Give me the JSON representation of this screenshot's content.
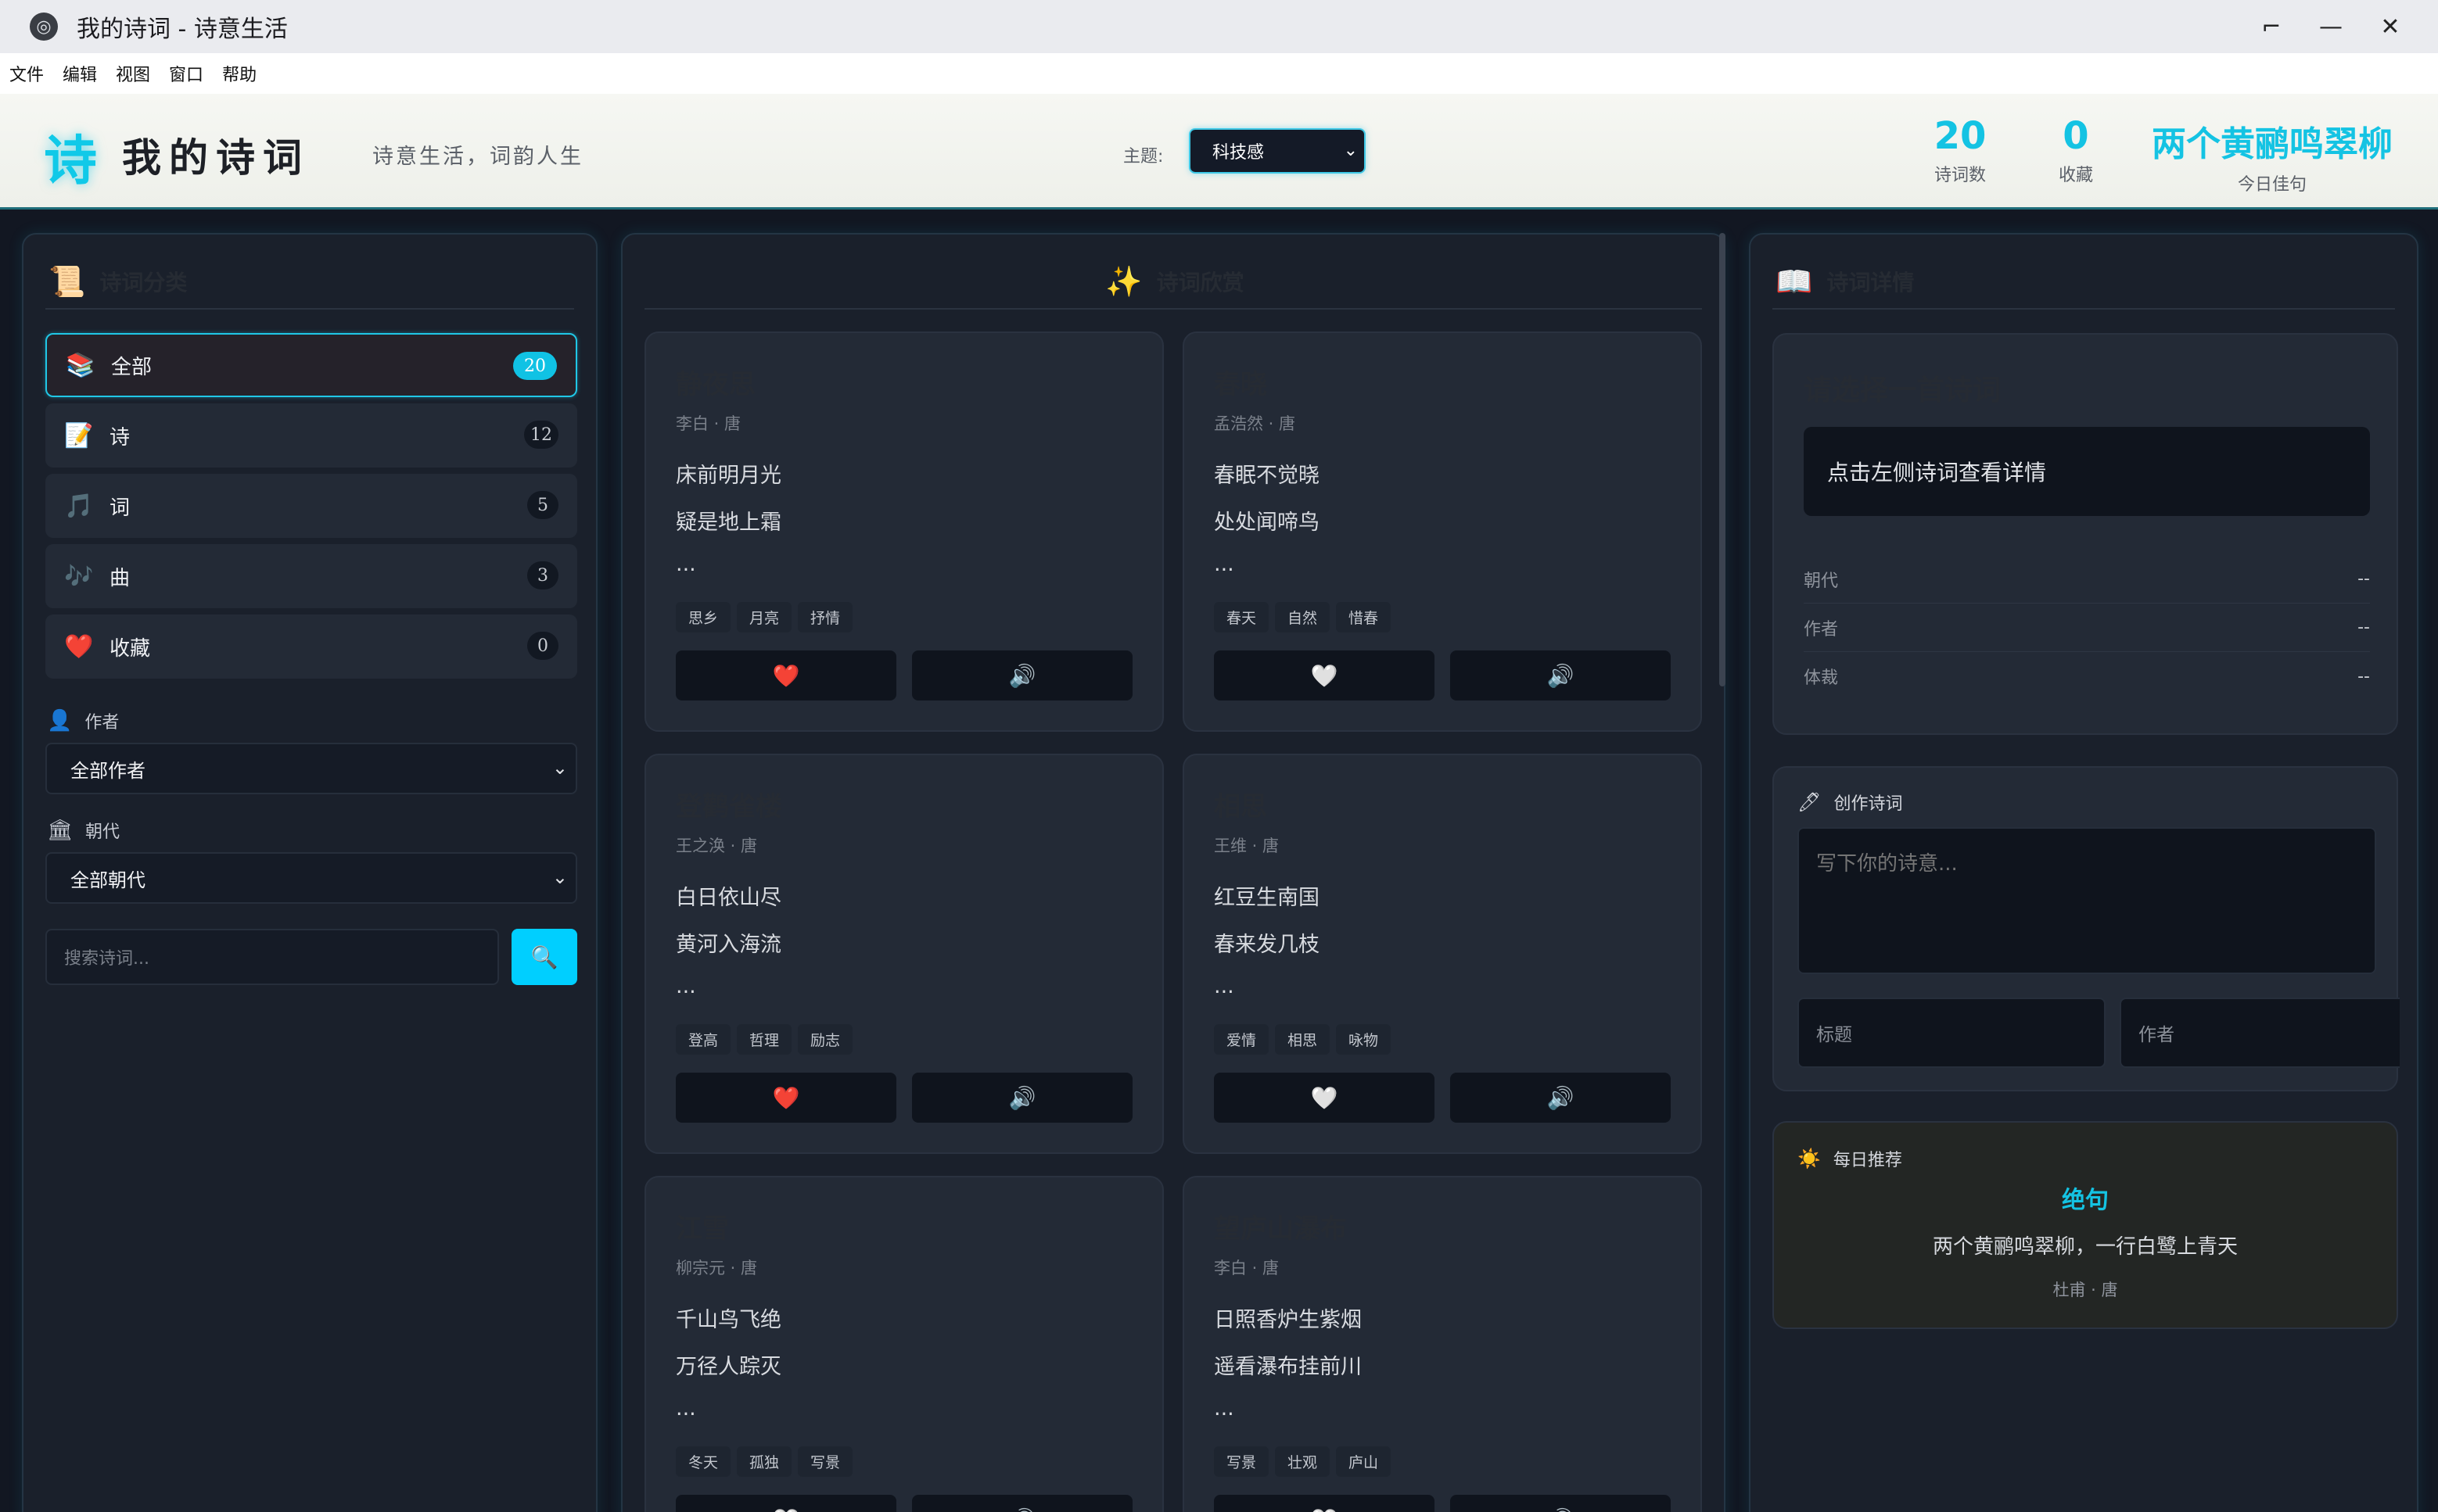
{
  "window": {
    "title": "我的诗词 - 诗意生活",
    "controls": {
      "restore": "⌐",
      "minimize": "—",
      "close": "✕"
    }
  },
  "menu": [
    "文件",
    "编辑",
    "视图",
    "窗口",
    "帮助"
  ],
  "header": {
    "logo_char": "诗",
    "app_name": "我的诗词",
    "slogan": "诗意生活，词韵人生",
    "theme_label": "主题:",
    "theme_value": "科技感",
    "stats": [
      {
        "value": "20",
        "label": "诗词数"
      },
      {
        "value": "0",
        "label": "收藏"
      }
    ],
    "daily_line": "两个黄鹂鸣翠柳",
    "daily_label": "今日佳句"
  },
  "sidebar": {
    "title": "诗词分类",
    "title_icon": "scroll-icon",
    "categories": [
      {
        "icon": "books-icon",
        "glyph": "📚",
        "label": "全部",
        "count": "20",
        "active": true
      },
      {
        "icon": "memo-icon",
        "glyph": "📝",
        "label": "诗",
        "count": "12",
        "active": false
      },
      {
        "icon": "music-icon",
        "glyph": "🎵",
        "label": "词",
        "count": "5",
        "active": false
      },
      {
        "icon": "note-icon",
        "glyph": "🎶",
        "label": "曲",
        "count": "3",
        "active": false
      },
      {
        "icon": "heart-icon",
        "glyph": "❤️",
        "label": "收藏",
        "count": "0",
        "active": false
      }
    ],
    "author_label": "作者",
    "author_value": "全部作者",
    "dynasty_label": "朝代",
    "dynasty_value": "全部朝代",
    "search_placeholder": "搜索诗词..."
  },
  "main": {
    "title": "诗词欣赏",
    "title_icon": "sparkles-icon",
    "poems": [
      {
        "title": "静夜思",
        "meta": "李白 · 唐",
        "lines": [
          "床前明月光",
          "疑是地上霜",
          "..."
        ],
        "tags": [
          "思乡",
          "月亮",
          "抒情"
        ],
        "fav": "❤️",
        "audio": "🔊"
      },
      {
        "title": "春晓",
        "meta": "孟浩然 · 唐",
        "lines": [
          "春眠不觉晓",
          "处处闻啼鸟",
          "..."
        ],
        "tags": [
          "春天",
          "自然",
          "惜春"
        ],
        "fav": "🤍",
        "audio": "🔊"
      },
      {
        "title": "登鹳雀楼",
        "meta": "王之涣 · 唐",
        "lines": [
          "白日依山尽",
          "黄河入海流",
          "..."
        ],
        "tags": [
          "登高",
          "哲理",
          "励志"
        ],
        "fav": "❤️",
        "audio": "🔊"
      },
      {
        "title": "相思",
        "meta": "王维 · 唐",
        "lines": [
          "红豆生南国",
          "春来发几枝",
          "..."
        ],
        "tags": [
          "爱情",
          "相思",
          "咏物"
        ],
        "fav": "🤍",
        "audio": "🔊"
      },
      {
        "title": "江雪",
        "meta": "柳宗元 · 唐",
        "lines": [
          "千山鸟飞绝",
          "万径人踪灭",
          "..."
        ],
        "tags": [
          "冬天",
          "孤独",
          "写景"
        ],
        "fav": "🤍",
        "audio": "🔊"
      },
      {
        "title": "望庐山瀑布",
        "meta": "李白 · 唐",
        "lines": [
          "日照香炉生紫烟",
          "遥看瀑布挂前川",
          "..."
        ],
        "tags": [
          "写景",
          "壮观",
          "庐山"
        ],
        "fav": "🤍",
        "audio": "🔊"
      }
    ]
  },
  "detail": {
    "title": "诗词详情",
    "title_icon": "open-book-icon",
    "placeholder_title": "请选择一首诗词",
    "placeholder_msg": "点击左侧诗词查看详情",
    "rows": [
      {
        "label": "朝代",
        "value": "--"
      },
      {
        "label": "作者",
        "value": "--"
      },
      {
        "label": "体裁",
        "value": "--"
      }
    ],
    "compose": {
      "title": "创作诗词",
      "text_placeholder": "写下你的诗意...",
      "title_placeholder": "标题",
      "author_placeholder": "作者"
    },
    "recommend": {
      "title": "每日推荐",
      "type": "绝句",
      "text": "两个黄鹂鸣翠柳，一行白鹭上青天",
      "author": "杜甫 · 唐"
    }
  },
  "colors": {
    "accent": "#14c3e3",
    "panel": "#1a202b",
    "card": "#232a36",
    "header_bg": "#f2f3ee"
  }
}
